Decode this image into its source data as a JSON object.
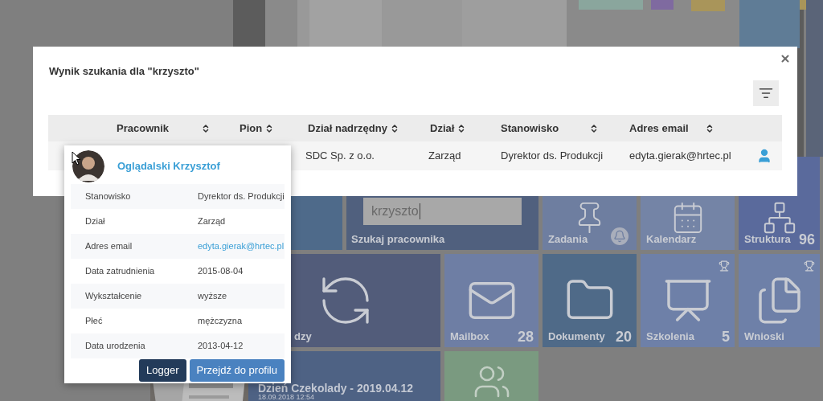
{
  "dashboard": {
    "search_tile": {
      "label": "Szukaj pracownika",
      "value": "krzyszto"
    },
    "tiles": [
      {
        "label": "Zadania"
      },
      {
        "label": "Kalendarz"
      },
      {
        "label": "Struktura",
        "count": "96"
      },
      {
        "label": "dzy"
      },
      {
        "label": "Mailbox",
        "count": "28"
      },
      {
        "label": "Dokumenty",
        "count": "20"
      },
      {
        "label": "Szkolenia",
        "count": "5"
      },
      {
        "label": "Wnioski"
      }
    ],
    "news_tile": {
      "title": "Dzień Czekolady - 2019.04.12",
      "date": "18.09.2018 12:54"
    }
  },
  "modal": {
    "title": "Wynik szukania dla \"krzyszto\"",
    "table": {
      "columns": [
        {
          "label": "Pracownik",
          "sortable": true
        },
        {
          "label": "Pion",
          "sortable": true
        },
        {
          "label": "Dział nadrzędny",
          "sortable": true
        },
        {
          "label": "Dział",
          "sortable": true
        },
        {
          "label": "Stanowisko",
          "sortable": true
        },
        {
          "label": "Adres email",
          "sortable": true
        }
      ],
      "rows": [
        {
          "cells": [
            "",
            "",
            "SDC Sp. z o.o.",
            "Zarząd",
            "Dyrektor ds. Produkcji",
            "edyta.gierak@hrtec.pl"
          ]
        }
      ]
    }
  },
  "profile_card": {
    "name": "Oglądalski Krzysztof",
    "fields": [
      {
        "label": "Stanowisko",
        "value": "Dyrektor ds. Produkcji",
        "kind": "text"
      },
      {
        "label": "Dział",
        "value": "Zarząd",
        "kind": "text"
      },
      {
        "label": "Adres email",
        "value": "edyta.gierak@hrtec.pl",
        "kind": "link"
      },
      {
        "label": "Data zatrudnienia",
        "value": "2015-08-04",
        "kind": "text"
      },
      {
        "label": "Wykształcenie",
        "value": "wyższe",
        "kind": "text"
      },
      {
        "label": "Płeć",
        "value": "mężczyzna",
        "kind": "text"
      },
      {
        "label": "Data urodzenia",
        "value": "2013-04-12",
        "kind": "text"
      }
    ],
    "buttons": [
      {
        "label": "Logger",
        "kind": "dark"
      },
      {
        "label": "Przejdź do profilu",
        "kind": "primary"
      }
    ]
  }
}
